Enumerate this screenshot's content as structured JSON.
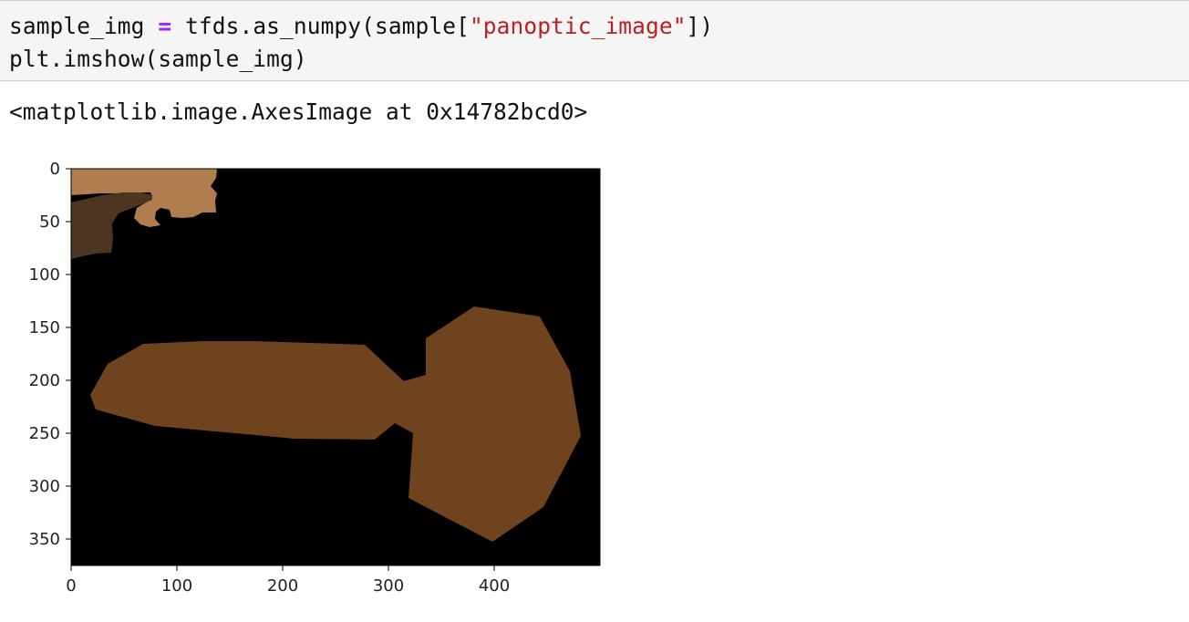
{
  "input_cell": {
    "line1": {
      "var": "sample_img ",
      "op": "=",
      "call": " tfds.as_numpy(sample[",
      "str": "\"panoptic_image\"",
      "end": "])"
    },
    "line2": "plt.imshow(sample_img)"
  },
  "output": {
    "text": "<matplotlib.image.AxesImage at 0x14782bcd0>"
  },
  "colors": {
    "image_background": "#000000",
    "region_light": "#b07d4f",
    "region_dark": "#4d3520",
    "region_main": "#6f431d"
  },
  "chart_data": {
    "type": "image",
    "x_ticks": [
      "0",
      "100",
      "200",
      "300",
      "400"
    ],
    "y_ticks": [
      "0",
      "50",
      "100",
      "150",
      "200",
      "250",
      "300",
      "350"
    ],
    "xlim": [
      0,
      500
    ],
    "ylim": [
      375,
      0
    ]
  }
}
